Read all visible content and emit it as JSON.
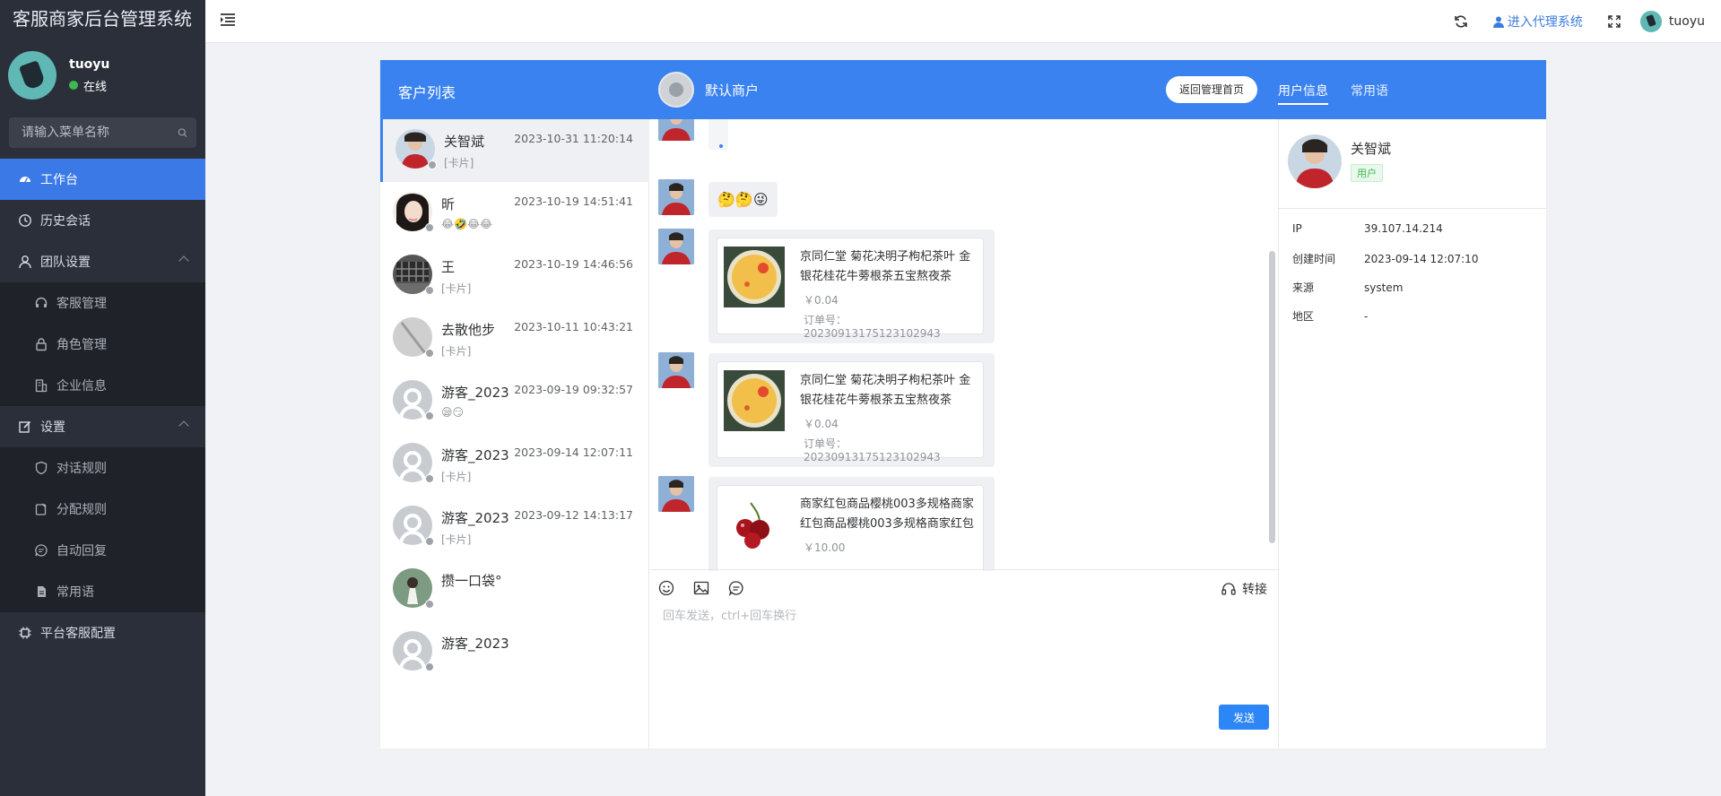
{
  "app": {
    "title": "客服商家后台管理系统"
  },
  "sidebar": {
    "user": {
      "name": "tuoyu",
      "status": "在线"
    },
    "search_placeholder": "请输入菜单名称",
    "menu": {
      "workbench": "工作台",
      "history": "历史会话",
      "team": "团队设置",
      "team_children": {
        "agents": "客服管理",
        "roles": "角色管理",
        "company": "企业信息"
      },
      "settings": "设置",
      "settings_children": {
        "chat_rules": "对话规则",
        "assign_rules": "分配规则",
        "auto_reply": "自动回复",
        "phrases": "常用语"
      },
      "platform": "平台客服配置"
    }
  },
  "topbar": {
    "agent_link": "进入代理系统",
    "username": "tuoyu"
  },
  "panel": {
    "list_title": "客户列表",
    "merchant": "默认商户",
    "back_btn": "返回管理首页",
    "tab_user": "用户信息",
    "tab_phrases": "常用语"
  },
  "customers": [
    {
      "name": "关智斌",
      "time": "2023-10-31 11:20:14",
      "sub": "[卡片]"
    },
    {
      "name": "昕",
      "time": "2023-10-19 14:51:41",
      "sub": "😂🤣😂😂"
    },
    {
      "name": "王",
      "time": "2023-10-19 14:46:56",
      "sub": "[卡片]"
    },
    {
      "name": "去散他步",
      "time": "2023-10-11 10:43:21",
      "sub": "[卡片]"
    },
    {
      "name": "游客_2023",
      "time": "2023-09-19 09:32:57",
      "sub": "😪😏"
    },
    {
      "name": "游客_2023",
      "time": "2023-09-14 12:07:11",
      "sub": "[卡片]"
    },
    {
      "name": "游客_2023",
      "time": "2023-09-12 14:13:17",
      "sub": "[卡片]"
    },
    {
      "name": "攒一口袋°",
      "time": "",
      "sub": ""
    },
    {
      "name": "游客_2023",
      "time": "",
      "sub": ""
    }
  ],
  "messages": {
    "emoji_msg": "🤔🤔😜",
    "products": [
      {
        "title": "京同仁堂 菊花决明子枸杞茶叶 金银花桂花牛蒡根茶五宝熬夜茶",
        "price": "￥0.04",
        "order": "订单号：20230913175123102943"
      },
      {
        "title": "京同仁堂 菊花决明子枸杞茶叶 金银花桂花牛蒡根茶五宝熬夜茶",
        "price": "￥0.04",
        "order": "订单号：20230913175123102943"
      },
      {
        "title": "商家红包商品樱桃003多规格商家红包商品樱桃003多规格商家红包",
        "price": "￥10.00"
      }
    ]
  },
  "composer": {
    "placeholder": "回车发送，ctrl+回车换行",
    "transfer": "转接",
    "send": "发送"
  },
  "user_info": {
    "name": "关智斌",
    "tag": "用户",
    "fields": [
      {
        "k": "IP",
        "v": "39.107.14.214"
      },
      {
        "k": "创建时间",
        "v": "2023-09-14 12:07:10"
      },
      {
        "k": "来源",
        "v": "system"
      },
      {
        "k": "地区",
        "v": "-"
      }
    ]
  },
  "colors": {
    "primary": "#3a82f0",
    "sidebar_bg": "#2b2f3a",
    "online": "#3fb950"
  },
  "icons": [
    "hamburger-icon",
    "refresh-icon",
    "user-icon",
    "fullscreen-icon",
    "search-icon",
    "dashboard-icon",
    "clock-icon",
    "team-icon",
    "headset-icon",
    "lock-icon",
    "building-icon",
    "edit-icon",
    "shield-icon",
    "assign-icon",
    "chat-icon",
    "file-icon",
    "chip-icon",
    "smile-icon",
    "image-icon",
    "comment-icon"
  ]
}
